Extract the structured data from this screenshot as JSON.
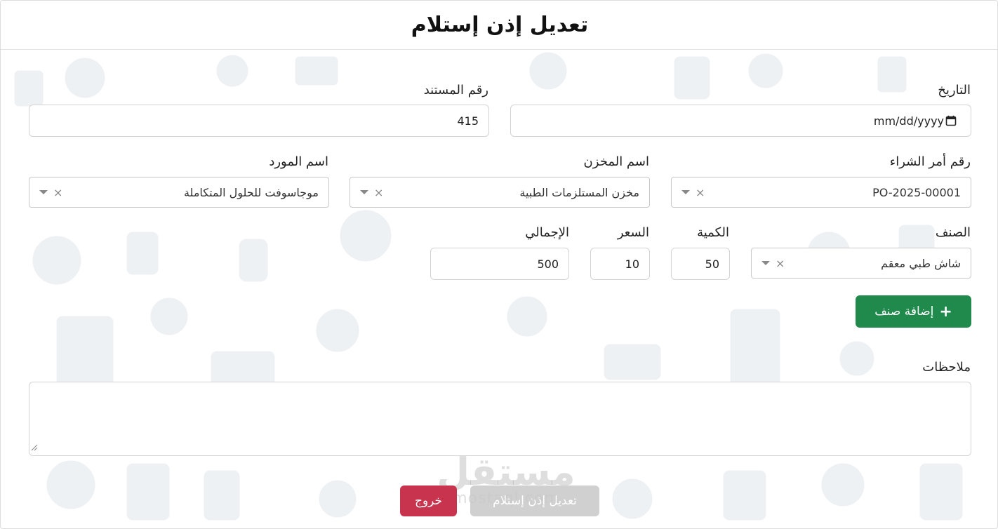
{
  "header": {
    "title": "تعديل إذن إستلام"
  },
  "form": {
    "date": {
      "label": "التاريخ",
      "placeholder": "mm/dd/yyyy",
      "icon": "calendar-icon"
    },
    "doc_number": {
      "label": "رقم المستند",
      "value": "415"
    },
    "po_number": {
      "label": "رقم أمر الشراء",
      "value": "PO-2025-00001"
    },
    "warehouse": {
      "label": "اسم المخزن",
      "value": "مخزن المستلزمات الطبية"
    },
    "supplier": {
      "label": "اسم المورد",
      "value": "موجاسوفت للحلول المتكاملة"
    },
    "item": {
      "label": "الصنف",
      "value": "شاش طبي معقم"
    },
    "quantity": {
      "label": "الكمية",
      "value": "50"
    },
    "price": {
      "label": "السعر",
      "value": "10"
    },
    "total": {
      "label": "الإجمالي",
      "value": "500"
    },
    "add_item_label": "إضافة صنف",
    "notes": {
      "label": "ملاحظات",
      "value": ""
    }
  },
  "footer": {
    "submit_label": "تعديل إذن إستلام",
    "exit_label": "خروج"
  },
  "watermark": {
    "arabic": "مستقل",
    "latin": "mostaql.com"
  },
  "colors": {
    "add_button": "#1f8a4c",
    "exit_button": "#c8334d",
    "submit_button_disabled": "#c8c8c8",
    "background_pattern": "#eef1f4"
  }
}
